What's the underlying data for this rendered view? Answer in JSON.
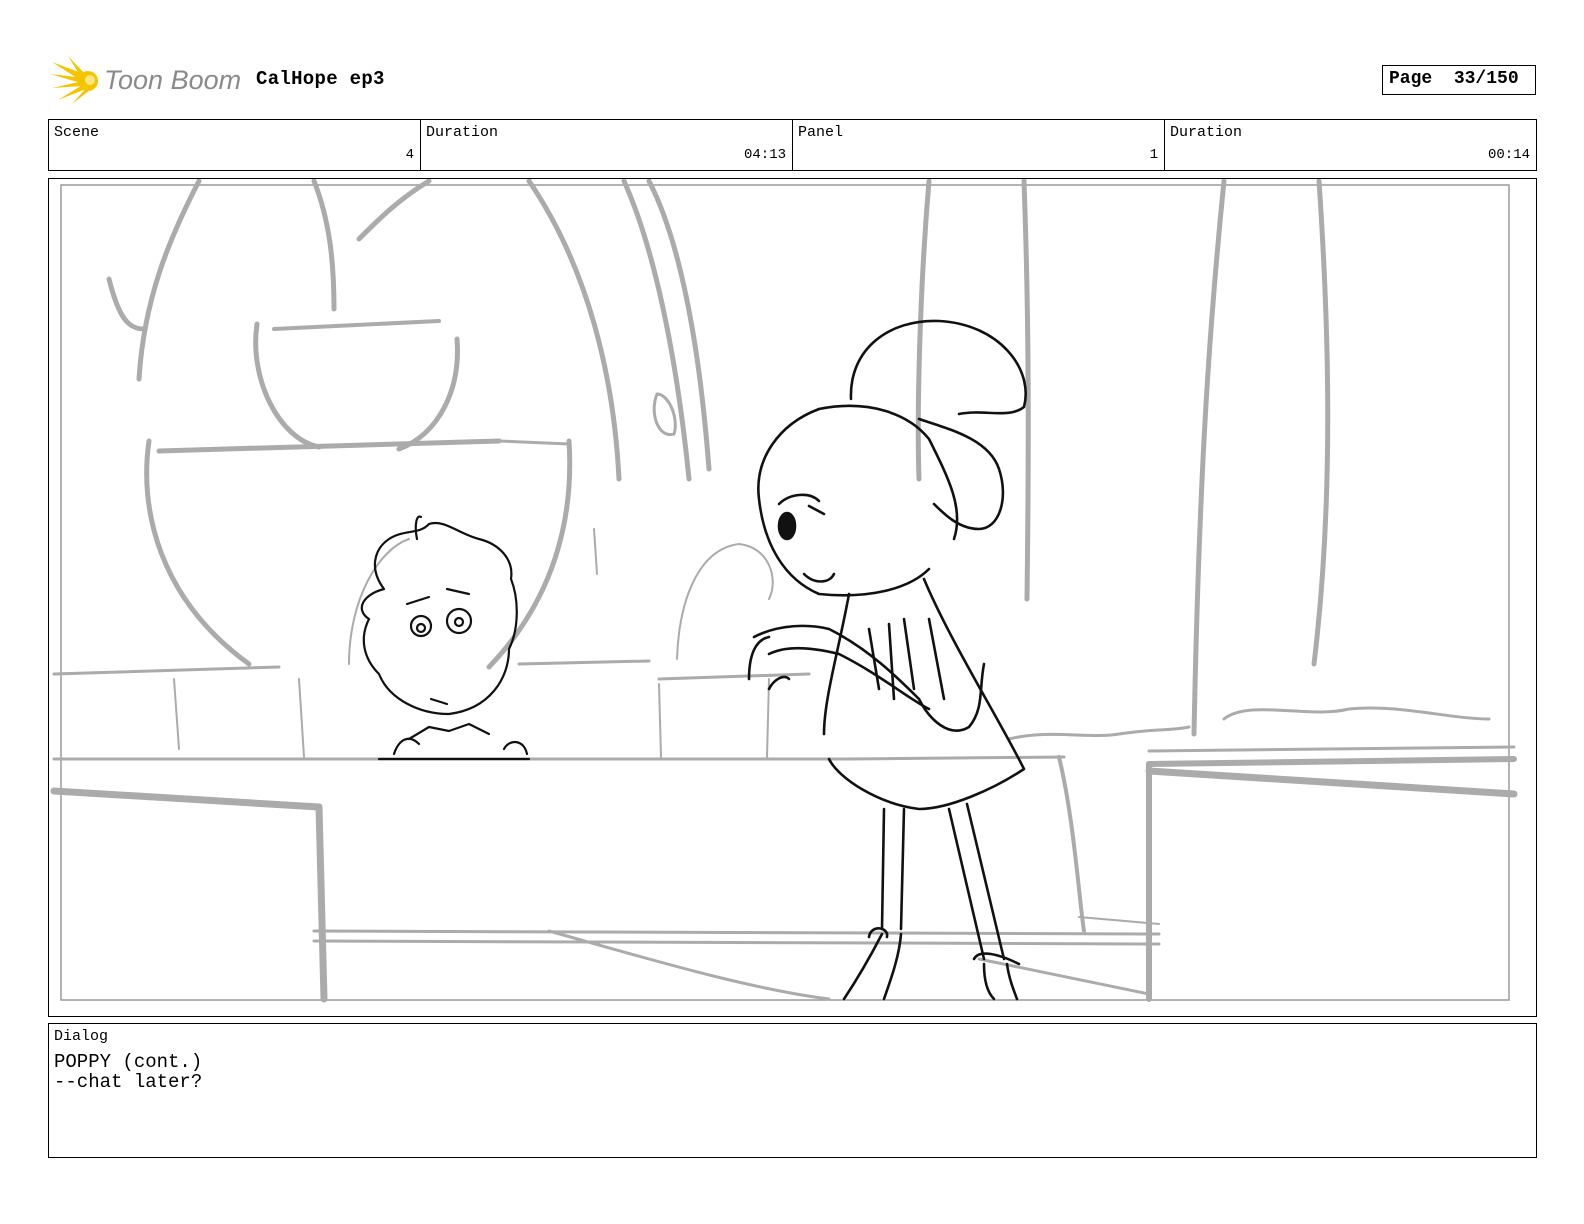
{
  "header": {
    "logo_text": "Toon Boom",
    "project_title": "CalHope ep3",
    "page_label": "Page",
    "page_value": "33/150"
  },
  "info": {
    "scene_label": "Scene",
    "scene_value": "4",
    "scene_duration_label": "Duration",
    "scene_duration_value": "04:13",
    "panel_label": "Panel",
    "panel_value": "1",
    "panel_duration_label": "Duration",
    "panel_duration_value": "00:14"
  },
  "dialog": {
    "label": "Dialog",
    "lines": [
      "POPPY (cont.)",
      "--chat later?"
    ]
  },
  "colors": {
    "logo_yellow": "#f5c400",
    "logo_text": "#8a8a8a",
    "sketch_gray": "#ababab",
    "sketch_black": "#111111"
  },
  "icons": {
    "logo": "toon-boom-starburst-icon"
  }
}
